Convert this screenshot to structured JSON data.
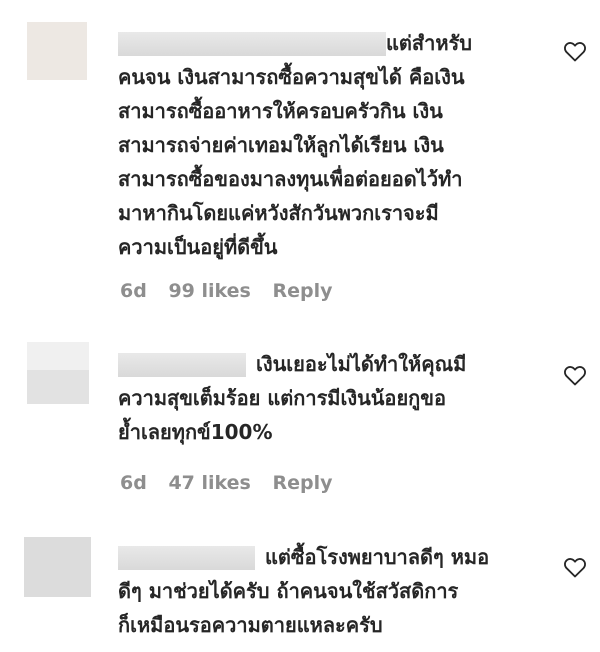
{
  "comments": [
    {
      "text_lines": [
        "แต่สำหรับ",
        "คนจน เงินสามารถซื้อความสุขได้ คือเงิน",
        "สามารถซื้ออาหารให้ครอบครัวกิน เงิน",
        "สามารถจ่ายค่าเทอมให้ลูกได้เรียน เงิน",
        "สามารถซื้อของมาลงทุนเพื่อต่อยอดไว้ทำ",
        "มาหากินโดยแค่หวังสักวันพวกเราจะมี",
        "ความเป็นอยู่ที่ดีขึ้น"
      ],
      "time": "6d",
      "likes": "99 likes",
      "reply": "Reply",
      "like_icon": "heart-outline-icon"
    },
    {
      "text_lines": [
        "เงินเยอะไม่ได้ทำให้คุณมี",
        "ความสุขเต็มร้อย แต่การมีเงินน้อยกูขอ",
        "ย้ำเลยทุกข์100%"
      ],
      "time": "6d",
      "likes": "47 likes",
      "reply": "Reply",
      "like_icon": "heart-outline-icon"
    },
    {
      "text_lines": [
        "แต่ซื้อโรงพยาบาลดีๆ หมอ",
        "ดีๆ มาช่วยได้ครับ ถ้าคนจนใช้สวัสดิการ",
        "ก็เหมือนรอความตายแหละครับ"
      ],
      "like_icon": "heart-outline-icon"
    }
  ]
}
